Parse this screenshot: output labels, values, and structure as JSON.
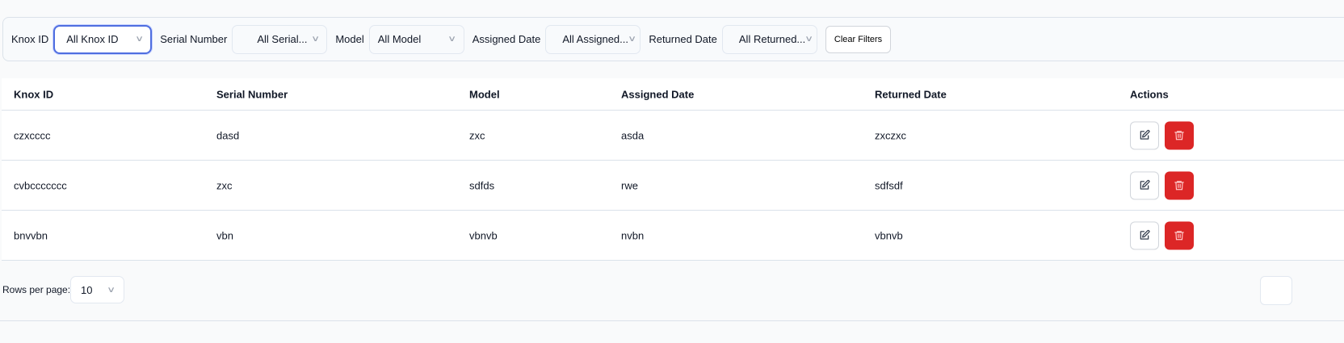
{
  "filters": [
    {
      "label": "Knox ID",
      "value": "All Knox ID"
    },
    {
      "label": "Serial Number",
      "value": "All Serial..."
    },
    {
      "label": "Model",
      "value": "All Model"
    },
    {
      "label": "Assigned Date",
      "value": "All Assigned..."
    },
    {
      "label": "Returned Date",
      "value": "All Returned..."
    }
  ],
  "clear_filters": "Clear Filters",
  "table": {
    "headers": [
      "Knox ID",
      "Serial Number",
      "Model",
      "Assigned Date",
      "Returned Date",
      "Actions"
    ],
    "rows": [
      [
        "czxcccc",
        "dasd",
        "zxc",
        "asda",
        "zxczxc"
      ],
      [
        "cvbccccccc",
        "zxc",
        "sdfds",
        "rwe",
        "sdfsdf"
      ],
      [
        "bnvvbn",
        "vbn",
        "vbnvb",
        "nvbn",
        "vbnvb"
      ]
    ]
  },
  "pagination": {
    "rows_per_page_label": "Rows per page:",
    "rows_per_page": "10"
  },
  "colors": {
    "accent": "#4f6ee0",
    "danger": "#dc2626"
  }
}
